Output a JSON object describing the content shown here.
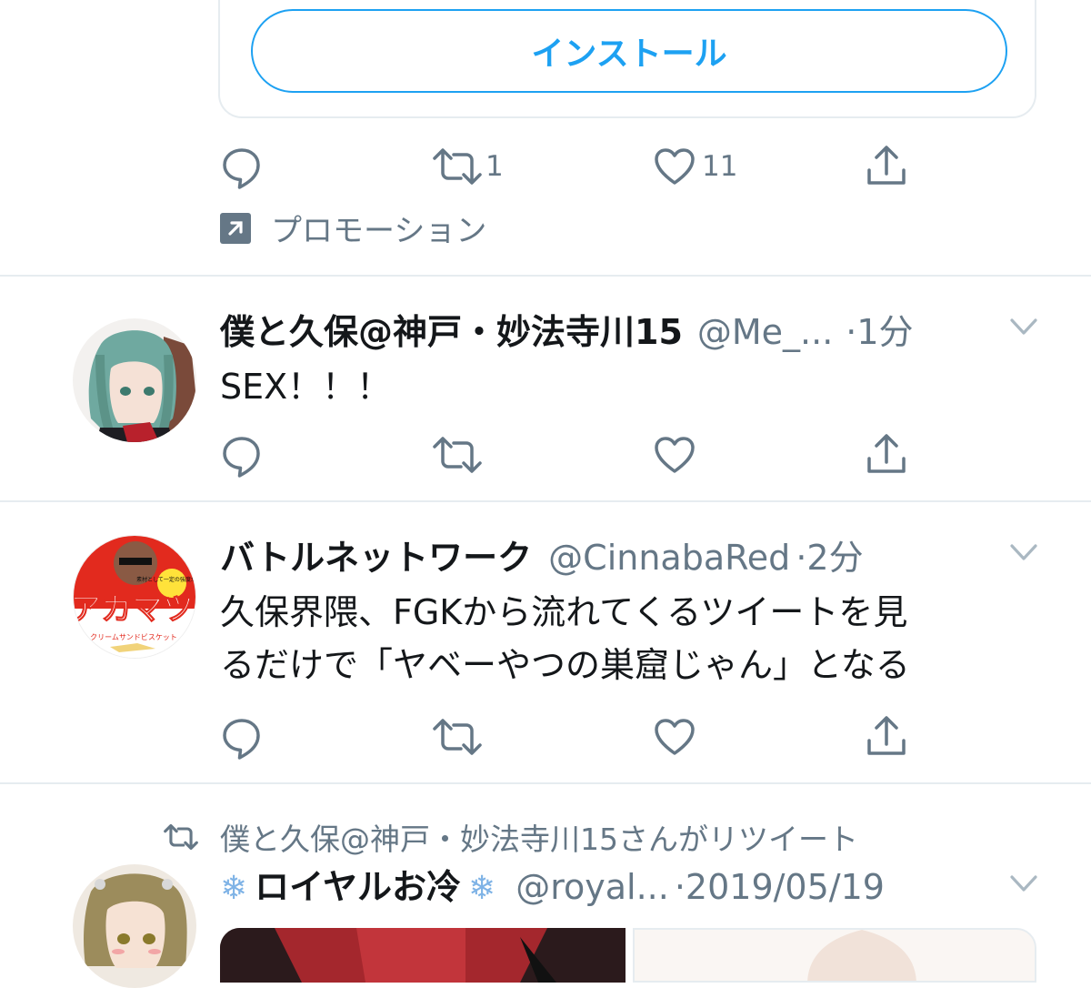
{
  "promo": {
    "install_label": "インストール",
    "retweet_count": "1",
    "like_count": "11",
    "promotion_label": "プロモーション"
  },
  "tweets": [
    {
      "name": "僕と久保@神戸・妙法寺川15",
      "handle": "@Me_...",
      "time": "·1分",
      "text_lines": [
        "SEX！！！"
      ]
    },
    {
      "name": "バトルネットワーク",
      "handle": "@CinnabaRed",
      "time": "·2分",
      "text_lines": [
        "久保界隈、FGKから流れてくるツイートを見",
        "るだけで「ヤベーやつの巣窟じゃん」となる"
      ],
      "avatar_text": {
        "main": "アカマツ",
        "badge": "素材として一定の強度がある",
        "sub": "クリームサンドビスケット"
      }
    },
    {
      "retweeted_by": "僕と久保@神戸・妙法寺川15さんがリツイート",
      "name": "ロイヤルお冷",
      "handle": "@royal...",
      "time": "·2019/05/19"
    }
  ],
  "colors": {
    "accent": "#1da1f2",
    "muted": "#657786",
    "divider": "#e6ecf0",
    "text": "#14171a"
  }
}
